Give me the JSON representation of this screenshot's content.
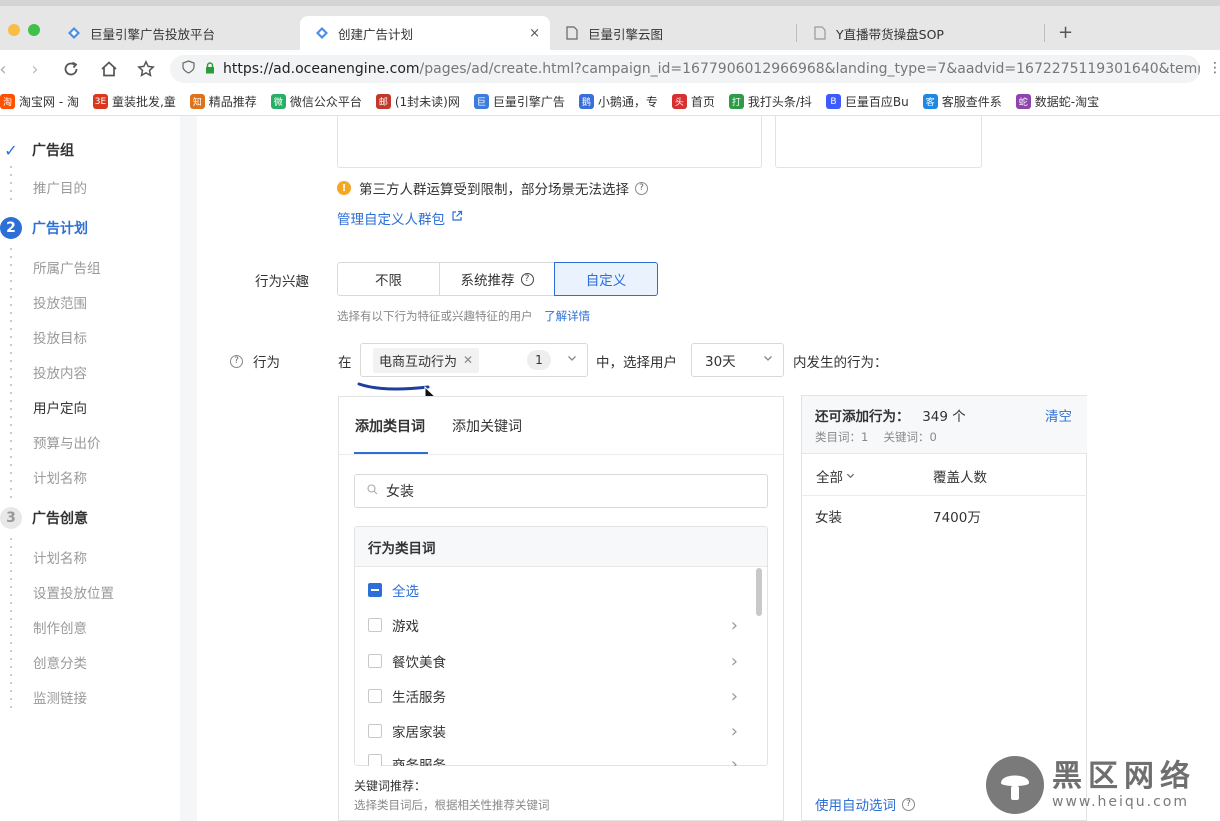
{
  "browser": {
    "tabs": [
      {
        "title": "巨量引擎广告投放平台",
        "icon": "oceanengine-logo-icon"
      },
      {
        "title": "创建广告计划",
        "icon": "oceanengine-logo-icon"
      },
      {
        "title": "巨量引擎云图",
        "icon": "document-icon"
      },
      {
        "title": "Y直播带货操盘SOP",
        "icon": "document-icon"
      }
    ],
    "close_glyph": "×",
    "new_tab_glyph": "+",
    "url_host": "https://ad.oceanengine.com",
    "url_path": "/pages/ad/create.html?campaign_id=1677906012966968&landing_type=7&aadvid=1672275119301640&temp_id=...",
    "bookmarks": [
      {
        "label": "淘宝网 - 淘",
        "color": "#ff5000",
        "glyph": "淘"
      },
      {
        "label": "童装批发,童",
        "color": "#d9381e",
        "glyph": "3E"
      },
      {
        "label": "精品推荐",
        "color": "#e0731a",
        "glyph": "知"
      },
      {
        "label": "微信公众平台",
        "color": "#2aae67",
        "glyph": "微"
      },
      {
        "label": "(1封未读)网",
        "color": "#c0392b",
        "glyph": "邮"
      },
      {
        "label": "巨量引擎广告",
        "color": "#3b7ddd",
        "glyph": "巨"
      },
      {
        "label": "小鹅通，专",
        "color": "#3a6fd8",
        "glyph": "鹅"
      },
      {
        "label": "首页",
        "color": "#d63031",
        "glyph": "头"
      },
      {
        "label": "我打头条/抖",
        "color": "#2c9c48",
        "glyph": "打"
      },
      {
        "label": "巨量百应Bu",
        "color": "#3d5afe",
        "glyph": "B"
      },
      {
        "label": "客服查件系",
        "color": "#1e88e5",
        "glyph": "客"
      },
      {
        "label": "数据蛇-淘宝",
        "color": "#8e44ad",
        "glyph": "蛇"
      }
    ]
  },
  "sidebar": {
    "step1": {
      "badge": "✓",
      "title": "广告组",
      "subs": [
        "推广目的"
      ]
    },
    "step2": {
      "badge": "2",
      "title": "广告计划",
      "subs": [
        "所属广告组",
        "投放范围",
        "投放目标",
        "投放内容",
        "用户定向",
        "预算与出价",
        "计划名称"
      ]
    },
    "step3": {
      "badge": "3",
      "title": "广告创意",
      "subs": [
        "计划名称",
        "设置投放位置",
        "制作创意",
        "创意分类",
        "监测链接"
      ]
    }
  },
  "form": {
    "warning": "第三方人群运算受到限制，部分场景无法选择",
    "manage_link": "管理自定义人群包",
    "interest_label": "行为兴趣",
    "interest_options": [
      "不限",
      "系统推荐",
      "自定义"
    ],
    "interest_hint": "选择有以下行为特征或兴趣特征的用户",
    "learn_more": "了解详情",
    "behavior_label": "行为",
    "in_text": "在",
    "behavior_chip": "电商互动行为",
    "behavior_count": "1",
    "mid_text": "中，选择用户",
    "days_value": "30天",
    "tail_text": "内发生的行为："
  },
  "picker": {
    "tabs": [
      "添加类目词",
      "添加关键词"
    ],
    "search_value": "女装",
    "category_header": "行为类目词",
    "items": [
      {
        "label": "全选",
        "state": "partial"
      },
      {
        "label": "游戏",
        "state": "unchecked"
      },
      {
        "label": "餐饮美食",
        "state": "unchecked"
      },
      {
        "label": "生活服务",
        "state": "unchecked"
      },
      {
        "label": "家居家装",
        "state": "unchecked"
      },
      {
        "label": "商务服务",
        "state": "unchecked"
      }
    ],
    "keyword_title": "关键词推荐：",
    "keyword_hint": "选择类目词后，根据相关性推荐关键词"
  },
  "selected_panel": {
    "title": "还可添加行为：",
    "count": "349 个",
    "clear": "清空",
    "stats": "类目词：1　 关键词：0",
    "col_all": "全部",
    "col_coverage": "覆盖人数",
    "rows": [
      {
        "name": "女装",
        "coverage": "7400万"
      }
    ],
    "auto_select": "使用自动选词"
  },
  "watermark": {
    "text": "黑区网络",
    "url": "www.heiqu.com"
  },
  "colors": {
    "accent": "#2d6fd6",
    "warning": "#f5a623",
    "annotation": "#1f3f9e"
  }
}
